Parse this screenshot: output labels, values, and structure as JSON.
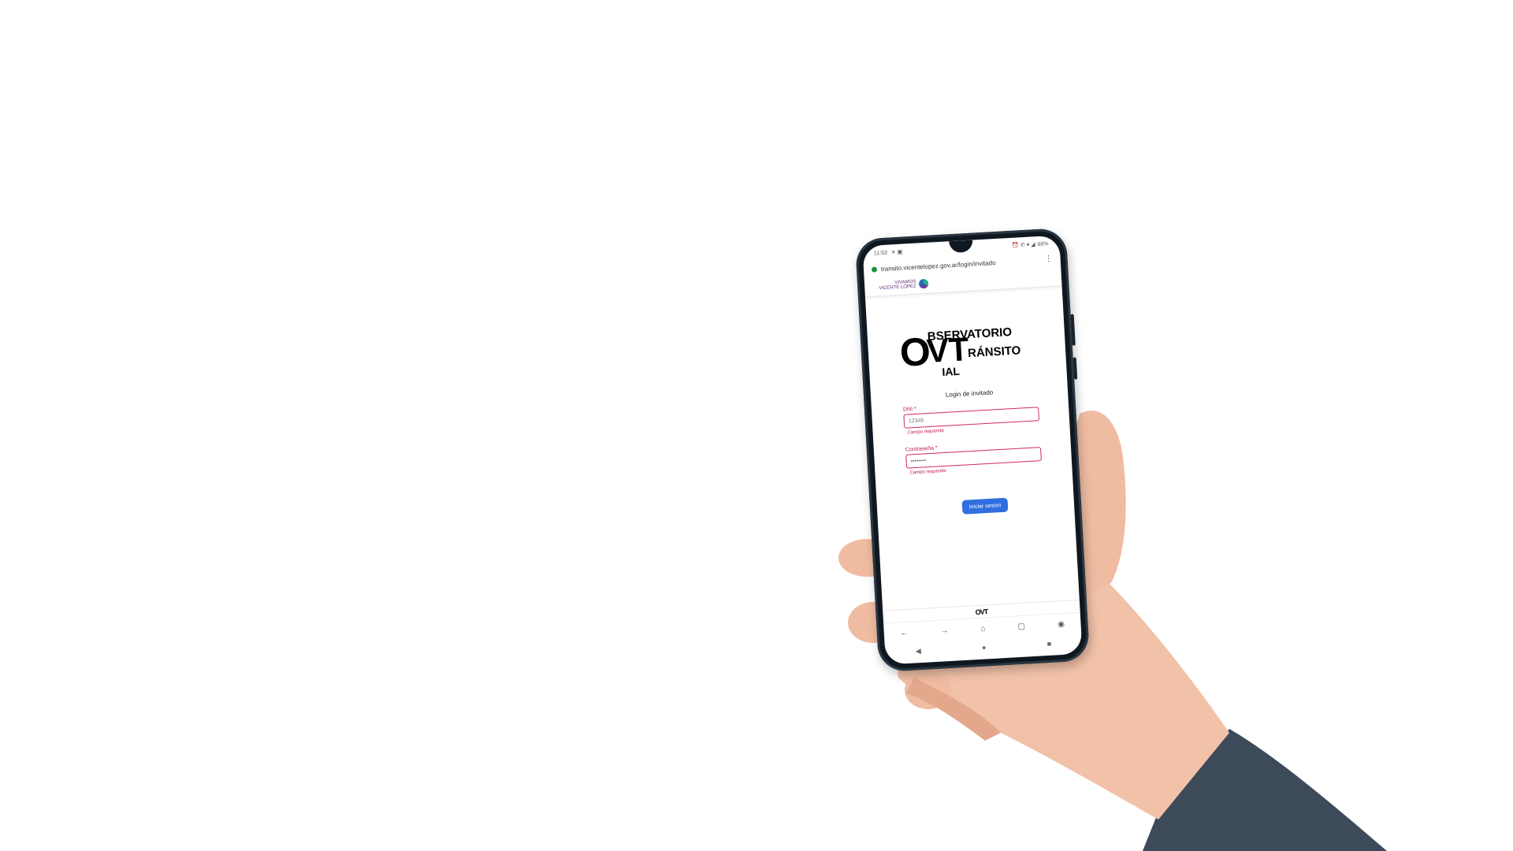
{
  "status_bar": {
    "time": "11:53",
    "battery": "66%"
  },
  "browser": {
    "url": "transito.vicentelopez.gov.ar/login/invitado",
    "menu_icon": "more-vert-icon",
    "nav_icons": [
      "back-arrow-icon",
      "forward-arrow-icon",
      "home-icon",
      "tabs-icon",
      "account-icon"
    ]
  },
  "site_header": {
    "brand_line1": "VIVAMOS",
    "brand_line2": "VICENTE LÓPEZ"
  },
  "logo": {
    "big_o": "O",
    "big_v": "V",
    "big_t": "T",
    "word1": "BSERVATORIO",
    "word2": "RÁNSITO",
    "word3": "IAL"
  },
  "login": {
    "title": "Login de invitado",
    "dni_label": "DNI *",
    "dni_value": "12345",
    "dni_error": "Campo requerido",
    "password_label": "Contraseña *",
    "password_value": "••••••••",
    "password_error": "Campo requerido",
    "submit_label": "Iniciar sesion"
  },
  "footer": {
    "logo_text": "OVT"
  },
  "colors": {
    "accent_blue": "#2f6fe0",
    "error_red": "#c0184a",
    "brand_purple": "#5b2d7a"
  }
}
